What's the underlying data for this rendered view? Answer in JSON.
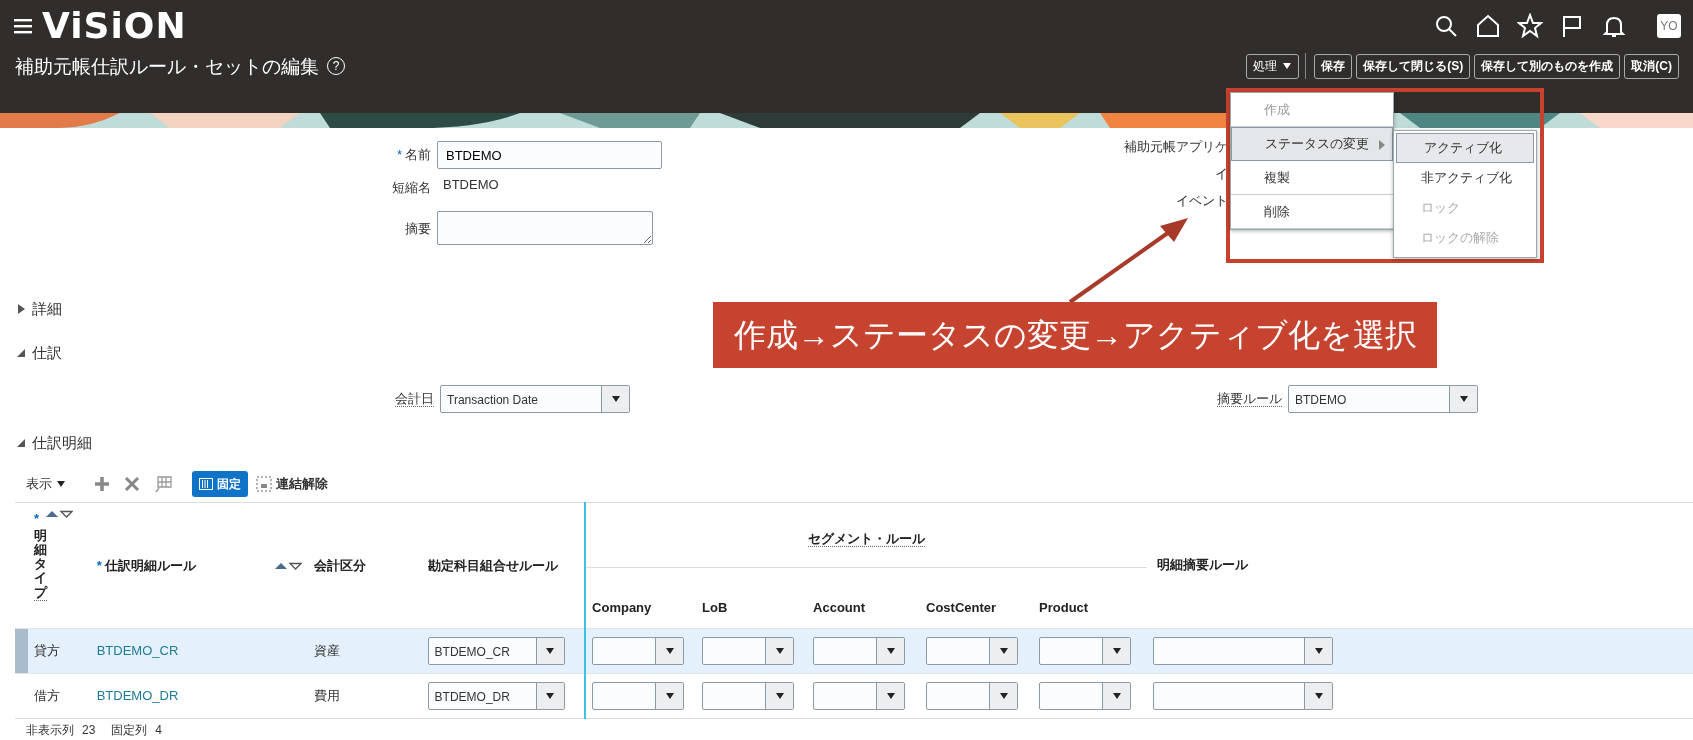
{
  "header": {
    "logo": "ViSiON",
    "avatar": "YO",
    "title": "補助元帳仕訳ルール・セットの編集",
    "help": "?"
  },
  "buttons": [
    {
      "label": "処理",
      "kind": "dropdown"
    },
    {
      "label": "保存",
      "kind": "plain"
    },
    {
      "label": "保存して閉じる(S)",
      "kind": "plain"
    },
    {
      "label": "保存して別のものを作成",
      "kind": "plain"
    },
    {
      "label": "取消(C)",
      "kind": "plain"
    }
  ],
  "menu": {
    "items": [
      {
        "label": "作成",
        "disabled": true,
        "selected": false,
        "submenu": false
      },
      {
        "label": "ステータスの変更",
        "disabled": false,
        "selected": true,
        "submenu": true
      },
      {
        "label": "複製",
        "disabled": false,
        "selected": false,
        "submenu": false
      },
      {
        "label": "削除",
        "disabled": false,
        "selected": false,
        "submenu": false
      }
    ],
    "submenu": [
      {
        "label": "アクティブ化",
        "disabled": false,
        "selected": true
      },
      {
        "label": "非アクティブ化",
        "disabled": false,
        "selected": false
      },
      {
        "label": "ロック",
        "disabled": true,
        "selected": false
      },
      {
        "label": "ロックの解除",
        "disabled": true,
        "selected": false
      }
    ]
  },
  "form": {
    "fields": [
      {
        "label": "名前",
        "required_mark": "*",
        "kind": "input",
        "value": "BTDEMO"
      },
      {
        "label": "短縮名",
        "kind": "text",
        "value": "BTDEMO"
      },
      {
        "label": "摘要",
        "kind": "textarea"
      }
    ],
    "right_fields": [
      {
        "label": "補助元帳アプリケ",
        "kind": "covered"
      },
      {
        "label": "イ",
        "kind": "covered"
      },
      {
        "label": "イベント",
        "kind": "covered"
      }
    ]
  },
  "callout": "作成→ステータスの変更→アクティブ化を選択",
  "sections": [
    {
      "label": "詳細",
      "expanded": false
    },
    {
      "label": "仕訳",
      "expanded": true
    },
    {
      "label": "仕訳明細",
      "expanded": true
    }
  ],
  "journal": {
    "accounting_date": {
      "label": "会計日",
      "value": "Transaction Date"
    },
    "description_rule": {
      "label": "摘要ルール",
      "value": "BTDEMO"
    }
  },
  "toolbar": {
    "view": "表示",
    "freeze": {
      "label": "固定",
      "selected": true
    },
    "detach": "連結解除"
  },
  "table": {
    "group_header": "セグメント・ルール",
    "columns": [
      {
        "label": "明細タイプ",
        "required_mark": "*",
        "sortable": true,
        "kind": "vertical"
      },
      {
        "label": "仕訳明細ルール",
        "required_mark": "*",
        "sortable": true,
        "kind": "plain"
      },
      {
        "label": "会計区分",
        "kind": "plain"
      },
      {
        "label": "勘定科目組合せルール",
        "kind": "plain"
      },
      {
        "label": "Company",
        "kind": "segment"
      },
      {
        "label": "LoB",
        "kind": "segment"
      },
      {
        "label": "Account",
        "kind": "segment"
      },
      {
        "label": "CostCenter",
        "kind": "segment"
      },
      {
        "label": "Product",
        "kind": "segment"
      },
      {
        "label": "明細摘要ルール",
        "kind": "plain"
      }
    ],
    "rows": [
      {
        "selected": true,
        "type": "貸方",
        "rule": "BTDEMO_CR",
        "category": "資産",
        "account_rule": "BTDEMO_CR"
      },
      {
        "selected": false,
        "type": "借方",
        "rule": "BTDEMO_DR",
        "category": "費用",
        "account_rule": "BTDEMO_DR"
      }
    ]
  },
  "footer": [
    {
      "label": "非表示列",
      "value": "23"
    },
    {
      "label": "固定列",
      "value": "4"
    }
  ]
}
